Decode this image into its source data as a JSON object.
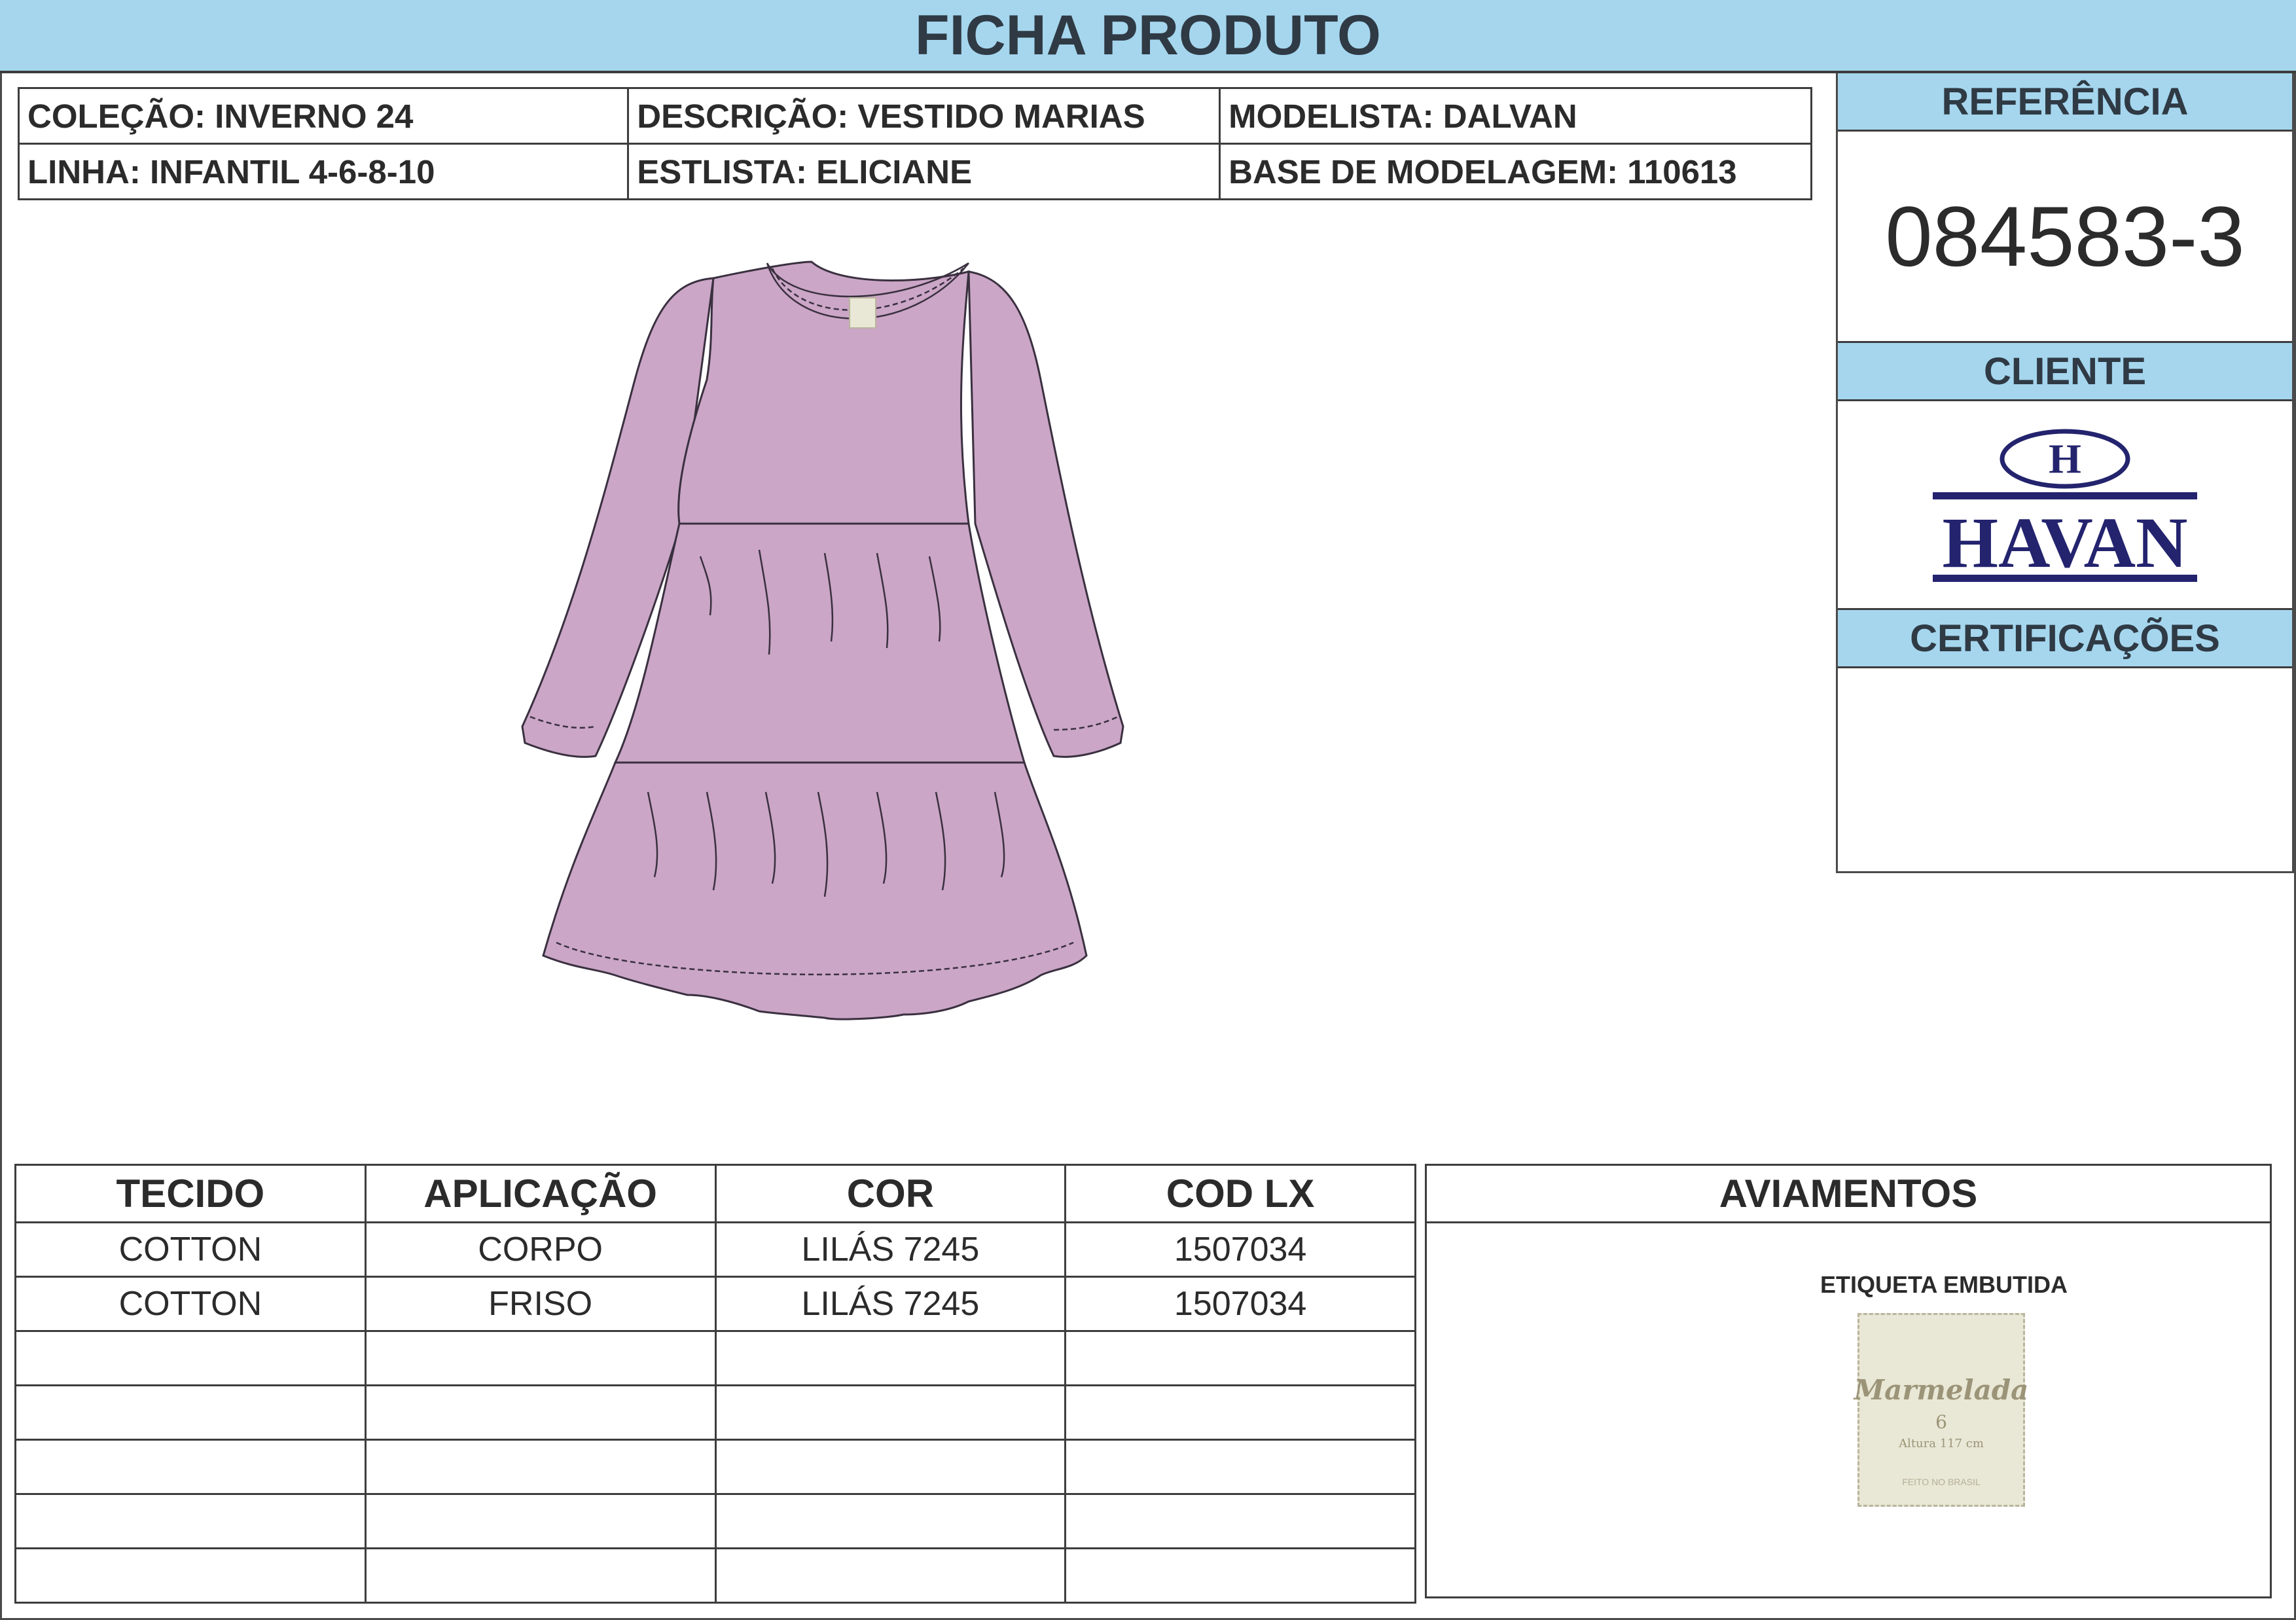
{
  "title": "FICHA PRODUTO",
  "info": {
    "colecao": "COLEÇÃO: INVERNO 24",
    "descricao": "DESCRIÇÃO: VESTIDO MARIAS",
    "modelista": "MODELISTA: DALVAN",
    "linha": "LINHA: INFANTIL 4-6-8-10",
    "estilista": "ESTLISTA: ELICIANE",
    "base": "BASE DE MODELAGEM: 110613"
  },
  "referencia": {
    "label": "REFERÊNCIA",
    "value": "084583-3"
  },
  "cliente": {
    "label": "CLIENTE",
    "logo_text": "HAVAN",
    "logo_letter": "H",
    "logo_color": "#23236e"
  },
  "certificacoes": {
    "label": "CERTIFICAÇÕES"
  },
  "garment": {
    "fill_color": "#cba6c6",
    "icon": "dress-illustration"
  },
  "fabric_table": {
    "headers": [
      "TECIDO",
      "APLICAÇÃO",
      "COR",
      "COD LX"
    ],
    "rows": [
      [
        "COTTON",
        "CORPO",
        "LILÁS 7245",
        "1507034"
      ],
      [
        "COTTON",
        "FRISO",
        "LILÁS 7245",
        "1507034"
      ],
      [
        "",
        "",
        "",
        ""
      ],
      [
        "",
        "",
        "",
        ""
      ],
      [
        "",
        "",
        "",
        ""
      ],
      [
        "",
        "",
        "",
        ""
      ],
      [
        "",
        "",
        "",
        ""
      ]
    ]
  },
  "aviamentos": {
    "label": "AVIAMENTOS",
    "item_label": "ETIQUETA EMBUTIDA",
    "tag": {
      "brand": "Marmelada",
      "size": "6",
      "height": "Altura 117 cm",
      "made": "FEITO NO BRASIL"
    }
  },
  "colors": {
    "header_bg": "#a5d6ee",
    "border": "#3d3d3d"
  }
}
